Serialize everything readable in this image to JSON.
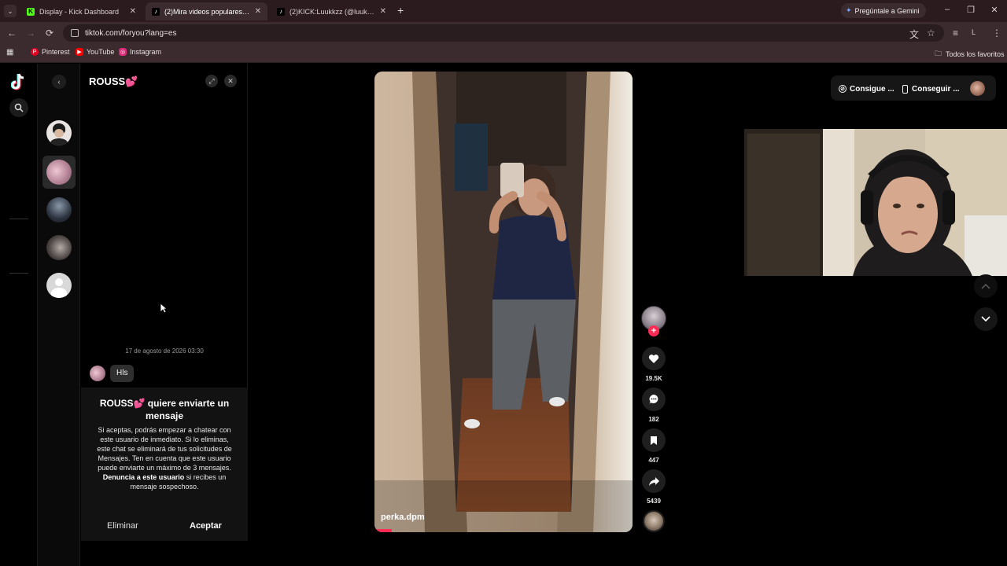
{
  "browser": {
    "tabs": [
      {
        "label": "Display - Kick Dashboard",
        "favicon": "kick-icon",
        "active": false
      },
      {
        "label": "(2)Mira videos populares seleccio",
        "favicon": "tiktok-icon",
        "active": true
      },
      {
        "label": "(2)KICK:Luukkzz (@luukkzz_) | T",
        "favicon": "tiktok-icon",
        "active": false
      }
    ],
    "gemini_label": "Pregúntale a Gemini",
    "url": "tiktok.com/foryou?lang=es",
    "profile_initial": "L",
    "bookmarks": [
      {
        "label": "Pinterest",
        "icon": "pinterest-icon",
        "color": "#e60023"
      },
      {
        "label": "YouTube",
        "icon": "youtube-icon",
        "color": "#ff0000"
      },
      {
        "label": "Instagram",
        "icon": "instagram-icon",
        "color": "#d62976"
      }
    ],
    "all_bookmarks_label": "Todos los favoritos"
  },
  "chat": {
    "title": "ROUSS💕",
    "timestamp": "17 de agosto de 2026 03:30",
    "message": "Hls",
    "request_title": "ROUSS💕 quiere enviarte un mensaje",
    "request_body_1": "Si aceptas, podrás empezar a chatear con este usuario de inmediato. Si lo eliminas, este chat se eliminará de tus solicitudes de Mensajes. Ten en cuenta que este usuario puede enviarte un máximo de 3 mensajes.",
    "request_body_report": "Denuncia a este usuario",
    "request_body_2": "si recibes un mensaje sospechoso.",
    "delete_label": "Eliminar",
    "accept_label": "Aceptar"
  },
  "video": {
    "author": "perka.dpm",
    "likes": "19.5K",
    "comments": "182",
    "saves": "447",
    "shares": "5439"
  },
  "topbar": {
    "get_coins_label": "Consigue ...",
    "get_app_label": "Conseguir ..."
  },
  "colors": {
    "tiktok_red": "#fe2c55",
    "chrome_dark": "#2b1b1f",
    "chrome_mid": "#3b2a2e"
  }
}
